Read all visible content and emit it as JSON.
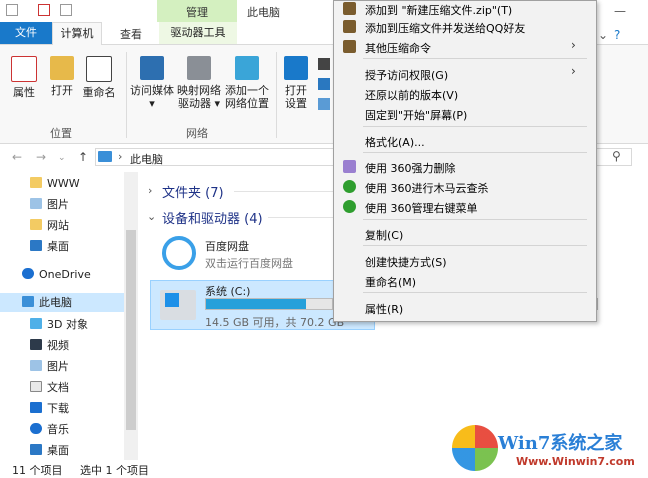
{
  "titlebar": {
    "contextual_group": "管理",
    "window_title": "此电脑"
  },
  "tabs": {
    "file": "文件",
    "computer": "计算机",
    "view": "查看",
    "drive_tools": "驱动器工具"
  },
  "ribbon": {
    "properties": "属性",
    "open": "打开",
    "rename": "重命名",
    "access_media_l1": "访问媒体",
    "access_media_l2": "▾",
    "map_drive_l1": "映射网络",
    "map_drive_l2": "驱动器 ▾",
    "add_location_l1": "添加一个",
    "add_location_l2": "网络位置",
    "open_settings_l1": "打开",
    "open_settings_l2": "设置",
    "group_location": "位置",
    "group_network": "网络"
  },
  "address": {
    "path": "此电脑"
  },
  "sidebar": {
    "items": [
      "WWW",
      "图片",
      "网站",
      "桌面",
      "OneDrive",
      "此电脑",
      "3D 对象",
      "视频",
      "图片",
      "文档",
      "下载",
      "音乐",
      "桌面"
    ]
  },
  "content": {
    "folders_header": "文件夹 (7)",
    "devices_header": "设备和驱动器 (4)",
    "baidu_name": "百度网盘",
    "baidu_desc": "双击运行百度网盘",
    "drive_c_name": "系统 (C:)",
    "drive_c_info": "14.5 GB 可用，共 70.2 GB",
    "drive_c_used_fraction": 0.79
  },
  "status": {
    "count": "11 个项目",
    "selected": "选中 1 个项目"
  },
  "context_menu": {
    "add_zip": "添加到 \"新建压缩文件.zip\"(T)",
    "add_zip_qq": "添加到压缩文件并发送给QQ好友",
    "other_compress": "其他压缩命令",
    "grant_access": "授予访问权限(G)",
    "restore_prev": "还原以前的版本(V)",
    "pin_start": "固定到\"开始\"屏幕(P)",
    "format": "格式化(A)...",
    "del_360": "使用 360强力删除",
    "scan_360": "使用 360进行木马云查杀",
    "manage_360": "使用 360管理右键菜单",
    "copy": "复制(C)",
    "shortcut": "创建快捷方式(S)",
    "rename": "重命名(M)",
    "properties": "属性(R)"
  },
  "watermark": {
    "title": "Win7系统之家",
    "url": "Www.Winwin7.com"
  },
  "colors": {
    "accent": "#1979ca",
    "selection": "#cce8ff",
    "context_tab": "#d4f0c0",
    "drive_bar": "#26a0da"
  }
}
